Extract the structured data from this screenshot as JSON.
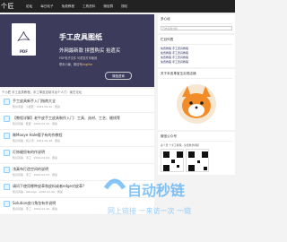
{
  "nav": {
    "logo": "个匠",
    "items": [
      "论坛",
      "每日帖子",
      "免费教程",
      "工具资料",
      "微信群",
      "搜帖"
    ]
  },
  "hero": {
    "doc_label": "PDF",
    "title": "手工皮具图纸",
    "subtitle": "外网最新款 拼图购买 拾遗买",
    "desc": "PDF电子文件 可重复打印使用",
    "contact_prefix": "联系小编，微信号",
    "contact_id": "jingjihe",
    "button": "微信咨询"
  },
  "feed": {
    "header": "个小匠 手工皮具教程，手工革皮定制平台个人门：案艺论坛",
    "articles": [
      {
        "title": "手工皮具新手入门指南大全",
        "meta": "知识问答 · 小匠匠 · 2022-04-20 · 阅读"
      },
      {
        "title": "【教程详解】老牛皮手工皮具制作入门：工具、选材、工艺、缝线等",
        "meta": "知识问答 · 匠匠 · 2022-04-20 · 阅读"
      },
      {
        "title": "做Mooye Hale帽子有的作教程",
        "meta": "知识问答 · 有人手 · 2022-02-28 · 阅读"
      },
      {
        "title": "灯饰缝纫有的作说明",
        "meta": "知识问答 · 手工 · 2022-02-04 · 阅读"
      },
      {
        "title": "浅真布打造空间的说明",
        "meta": "知识问答 · 手工 · 2022-02-03 · 阅读"
      },
      {
        "title": "请问下使用哪种皮革和皮料或者edge对皮革?",
        "meta": "知识问答 · leibeige · 2022-01-20 · 阅读"
      },
      {
        "title": "Solution皮口角包有作说明",
        "meta": "知识问答 · 手工 · 2022-01-10 · 阅读"
      }
    ]
  },
  "sidebar": {
    "subscribe_title": "多心经",
    "subscribe_placeholder": "日志标准分析",
    "recent_title": "栏目列表",
    "recent": [
      "免费教程 手工皮具教程",
      "免费教程 手工皮具教程",
      "免费教程 手工皮具教程",
      "免费教程 手工皮具教程"
    ],
    "mascot_title": "关于本皮革宝玉实现店铺",
    "wechat_title": "微信公众号",
    "wechat_desc": "多个皮 个手工教程，免费教学视频"
  },
  "watermark": {
    "brand": "自动秒链",
    "slogan": "网上链接 一来访一次 一链"
  },
  "colors": {
    "nav": "#222222",
    "hero": "#3d3b5c",
    "accent": "#2196f3",
    "mascot": "#f28c28"
  }
}
